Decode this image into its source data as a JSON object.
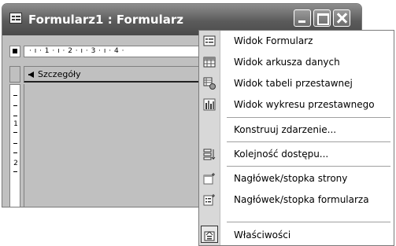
{
  "window": {
    "title": "Formularz1 : Formularz",
    "ruler_text": "· ı · 1 · ı · 2 · ı · 3 · ı · 4 ·",
    "vertical_ruler_numbers": [
      "1",
      "2"
    ],
    "section_label": "Szczegóły"
  },
  "context_menu": {
    "items": [
      {
        "label": "Widok Formularz",
        "icon": "form-view-icon"
      },
      {
        "label": "Widok arkusza danych",
        "icon": "datasheet-view-icon"
      },
      {
        "label": "Widok tabeli przestawnej",
        "icon": "pivot-table-view-icon"
      },
      {
        "label": "Widok wykresu przestawnego",
        "icon": "pivot-chart-view-icon"
      },
      {
        "label": "Konstruuj zdarzenie...",
        "icon": ""
      },
      {
        "label": "Kolejność dostępu...",
        "icon": "tab-order-icon"
      },
      {
        "label": "Nagłówek/stopka strony",
        "icon": "page-header-footer-icon"
      },
      {
        "label": "Nagłówek/stopka formularza",
        "icon": "form-header-footer-icon"
      },
      {
        "label": "Właściwości",
        "icon": "properties-icon"
      }
    ]
  }
}
